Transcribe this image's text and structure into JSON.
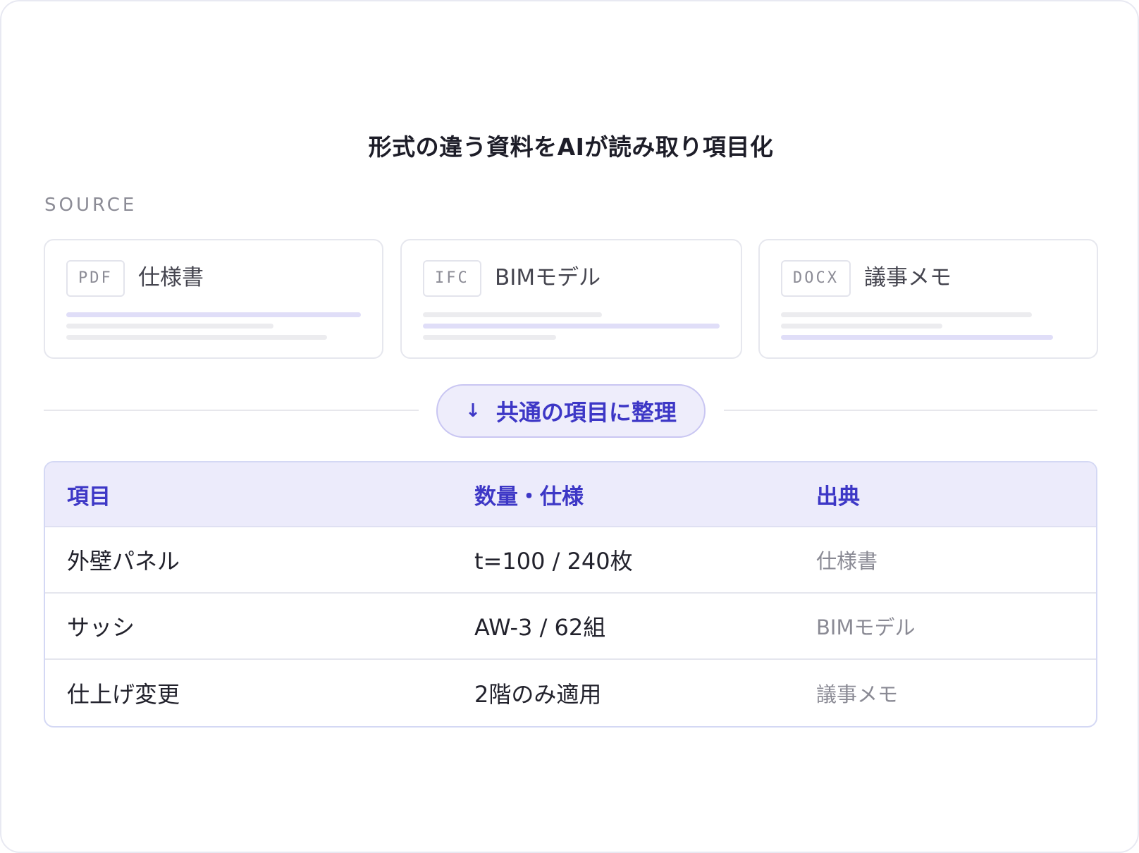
{
  "title": "形式の違う資料をAIが読み取り項目化",
  "source_label": "SOURCE",
  "sources": [
    {
      "format": "PDF",
      "name": "仕様書"
    },
    {
      "format": "IFC",
      "name": "BIMモデル"
    },
    {
      "format": "DOCX",
      "name": "議事メモ"
    }
  ],
  "organize": {
    "arrow_icon": "arrow-down-icon",
    "label": "共通の項目に整理"
  },
  "table": {
    "headers": [
      "項目",
      "数量・仕様",
      "出典"
    ],
    "rows": [
      [
        "外壁パネル",
        "t=100 / 240枚",
        "仕様書"
      ],
      [
        "サッシ",
        "AW-3 / 62組",
        "BIMモデル"
      ],
      [
        "仕上げ変更",
        "2階のみ適用",
        "議事メモ"
      ]
    ]
  },
  "colors": {
    "accent": "#3d37c6",
    "accent_soft": "#ecebfb",
    "highlight_line": "#e0def8"
  }
}
